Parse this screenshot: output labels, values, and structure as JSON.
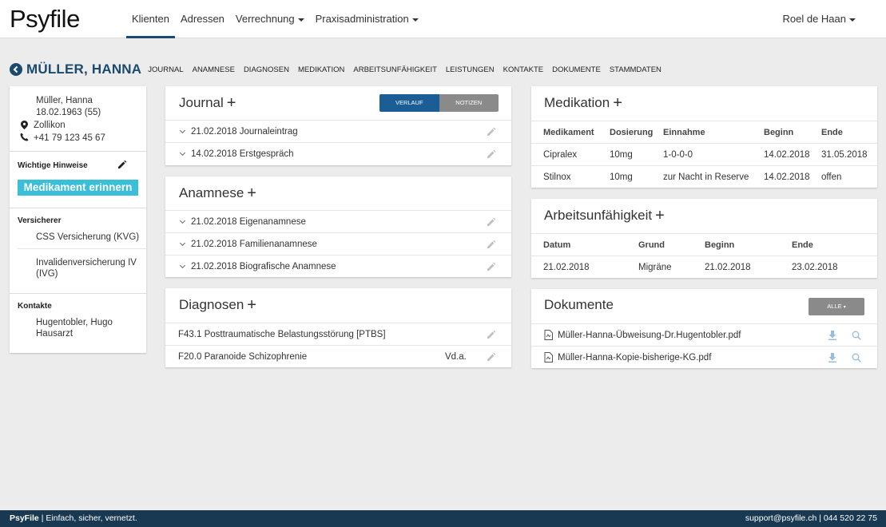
{
  "app": {
    "logo": "Psyfile"
  },
  "nav": {
    "items": [
      {
        "label": "Klienten",
        "active": true,
        "dropdown": false
      },
      {
        "label": "Adressen",
        "active": false,
        "dropdown": false
      },
      {
        "label": "Verrechnung",
        "active": false,
        "dropdown": true
      },
      {
        "label": "Praxisadministration",
        "active": false,
        "dropdown": true
      }
    ],
    "user": "Roel de Haan"
  },
  "patient": {
    "name": "MÜLLER, HANNA",
    "tabs": [
      "JOURNAL",
      "ANAMNESE",
      "DIAGNOSEN",
      "MEDIKATION",
      "ARBEITSUNFÄHIGKEIT",
      "LEISTUNGEN",
      "KONTAKTE",
      "DOKUMENTE",
      "STAMMDATEN"
    ]
  },
  "sidebar": {
    "name": "Müller, Hanna",
    "birth": "18.02.1963 (55)",
    "city": "Zollikon",
    "phone": "+41 79 123 45 67",
    "hints_label": "Wichtige Hinweise",
    "hint_badge": "Medikament erinnern",
    "insurer_label": "Versicherer",
    "insurers": [
      "CSS Versicherung (KVG)",
      "Invalidenversicherung IV (IVG)"
    ],
    "contacts_label": "Kontakte",
    "contact": "Hugentobler, Hugo Hausarzt"
  },
  "journal": {
    "title": "Journal",
    "toggle": [
      "VERLAUF",
      "NOTIZEN"
    ],
    "entries": [
      "21.02.2018 Journaleintrag",
      "14.02.2018 Erstgespräch"
    ]
  },
  "anamnese": {
    "title": "Anamnese",
    "entries": [
      "21.02.2018 Eigenanamnese",
      "21.02.2018 Familienanamnese",
      "21.02.2018 Biografische Anamnese"
    ]
  },
  "diagnosen": {
    "title": "Diagnosen",
    "entries": [
      {
        "label": "F43.1 Posttraumatische Belastungsstörung [PTBS]",
        "note": ""
      },
      {
        "label": "F20.0 Paranoide Schizophrenie",
        "note": "Vd.a."
      }
    ]
  },
  "medikation": {
    "title": "Medikation",
    "headers": [
      "Medikament",
      "Dosierung",
      "Einnahme",
      "Beginn",
      "Ende"
    ],
    "rows": [
      [
        "Cipralex",
        "10mg",
        "1-0-0-0",
        "14.02.2018",
        "31.05.2018"
      ],
      [
        "Stilnox",
        "10mg",
        "zur Nacht in Reserve",
        "14.02.2018",
        "offen"
      ]
    ]
  },
  "arbeit": {
    "title": "Arbeitsunfähigkeit",
    "headers": [
      "Datum",
      "Grund",
      "Beginn",
      "Ende"
    ],
    "rows": [
      [
        "21.02.2018",
        "Migräne",
        "21.02.2018",
        "23.02.2018"
      ]
    ]
  },
  "dokumente": {
    "title": "Dokumente",
    "button": "ALLE",
    "files": [
      "Müller-Hanna-Übweisung-Dr.Hugentobler.pdf",
      "Müller-Hanna-Kopie-bisherige-KG.pdf"
    ]
  },
  "footer": {
    "brand": "PsyFile",
    "slogan": " | Einfach, sicher, vernetzt.",
    "contact": "support@psyfile.ch | 044 520 22 75"
  },
  "colors": {
    "primary": "#1a4a6e",
    "accent": "#3bbfd8",
    "toggle_on": "#1b5e96",
    "footer": "#193952"
  }
}
